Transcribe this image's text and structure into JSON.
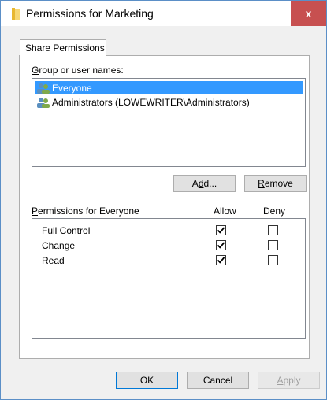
{
  "window": {
    "title": "Permissions for Marketing",
    "close_label": "x"
  },
  "tabs": [
    {
      "label": "Share Permissions",
      "active": true
    }
  ],
  "group": {
    "label_prefix": "",
    "label_u": "G",
    "label_rest": "roup or user names:",
    "users": [
      {
        "name": "Everyone",
        "selected": true,
        "icon": "users-icon"
      },
      {
        "name": "Administrators (LOWEWRITER\\Administrators)",
        "selected": false,
        "icon": "users-icon"
      }
    ]
  },
  "buttons": {
    "add_pre": "A",
    "add_u": "d",
    "add_post": "d...",
    "remove_u": "R",
    "remove_post": "emove",
    "ok": "OK",
    "cancel": "Cancel",
    "apply_u": "A",
    "apply_post": "pply"
  },
  "permissions": {
    "header_u": "P",
    "header_rest": "ermissions for Everyone",
    "allow_label": "Allow",
    "deny_label": "Deny",
    "rows": [
      {
        "name": "Full Control",
        "allow": true,
        "deny": false
      },
      {
        "name": "Change",
        "allow": true,
        "deny": false
      },
      {
        "name": "Read",
        "allow": true,
        "deny": false
      }
    ]
  },
  "colors": {
    "selection": "#3399ff",
    "close_button": "#c75050",
    "folder_icon": "#f2c94c"
  }
}
